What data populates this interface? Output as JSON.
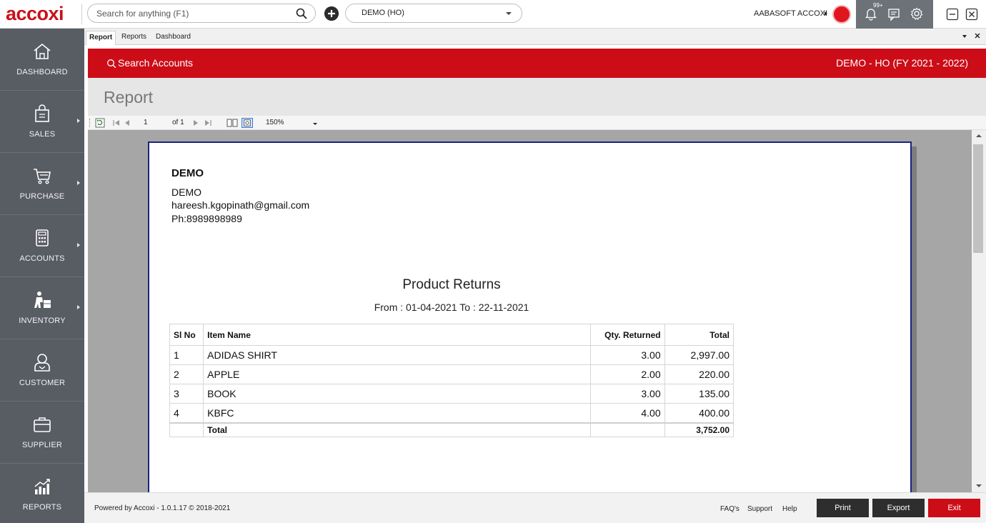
{
  "header": {
    "logo": "accoxi",
    "search_placeholder": "Search for anything (F1)",
    "company_selected": "DEMO (HO)",
    "user_name": "AABASOFT ACCOXI",
    "notification_badge": "99+"
  },
  "sidebar": {
    "items": [
      {
        "label": "DASHBOARD",
        "icon": "home-icon",
        "has_submenu": false
      },
      {
        "label": "SALES",
        "icon": "shopping-bag-icon",
        "has_submenu": true
      },
      {
        "label": "PURCHASE",
        "icon": "cart-icon",
        "has_submenu": true
      },
      {
        "label": "ACCOUNTS",
        "icon": "calculator-icon",
        "has_submenu": true
      },
      {
        "label": "INVENTORY",
        "icon": "inventory-icon",
        "has_submenu": true
      },
      {
        "label": "CUSTOMER",
        "icon": "customer-icon",
        "has_submenu": false
      },
      {
        "label": "SUPPLIER",
        "icon": "briefcase-icon",
        "has_submenu": false
      },
      {
        "label": "REPORTS",
        "icon": "reports-chart-icon",
        "has_submenu": false
      }
    ]
  },
  "tabs": [
    {
      "label": "Report",
      "active": true
    },
    {
      "label": "Reports",
      "active": false
    },
    {
      "label": "Dashboard",
      "active": false
    }
  ],
  "banner": {
    "search_label": "Search Accounts",
    "company_fy": "DEMO - HO (FY 2021 - 2022)"
  },
  "page_title": "Report",
  "toolbar": {
    "current_page": "1",
    "page_of": "of 1",
    "zoom": "150%"
  },
  "report": {
    "company_name": "DEMO",
    "company_line_1": "DEMO",
    "company_email": "hareesh.kgopinath@gmail.com",
    "company_phone": "Ph:8989898989",
    "title": "Product Returns",
    "date_range": "From : 01-04-2021 To : 22-11-2021",
    "columns": [
      "Sl No",
      "Item Name",
      "Qty. Returned",
      "Total"
    ],
    "rows": [
      {
        "sl": "1",
        "item": "ADIDAS SHIRT",
        "qty": "3.00",
        "total": "2,997.00"
      },
      {
        "sl": "2",
        "item": "APPLE",
        "qty": "2.00",
        "total": "220.00"
      },
      {
        "sl": "3",
        "item": "BOOK",
        "qty": "3.00",
        "total": "135.00"
      },
      {
        "sl": "4",
        "item": "KBFC",
        "qty": "4.00",
        "total": "400.00"
      }
    ],
    "total_label": "Total",
    "grand_total": "3,752.00"
  },
  "footer": {
    "powered_by": "Powered by Accoxi - 1.0.1.17 © 2018-2021",
    "faq": "FAQ's",
    "support": "Support",
    "help": "Help",
    "print": "Print",
    "export": "Export",
    "exit": "Exit"
  },
  "colors": {
    "brand_red": "#cc0d18",
    "sidebar_bg": "#585c63",
    "page_border": "#1a237e"
  }
}
